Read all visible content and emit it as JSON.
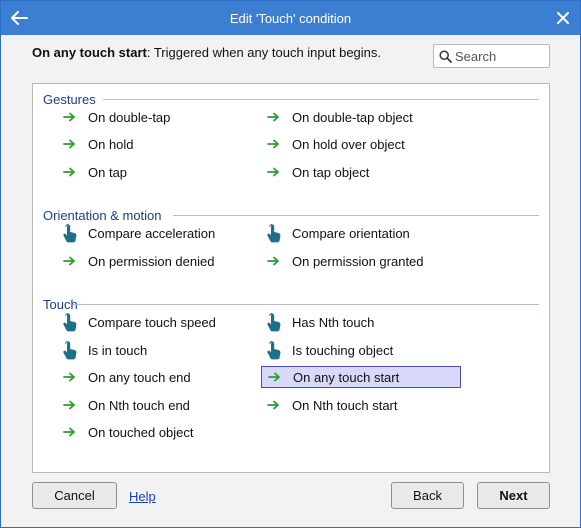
{
  "window": {
    "title": "Edit 'Touch' condition"
  },
  "description": {
    "name": "On any touch start",
    "text": ": Triggered when any touch input begins."
  },
  "search": {
    "placeholder": "Search"
  },
  "sections": [
    {
      "label": "Gestures",
      "items": [
        {
          "label": "On double-tap",
          "icon": "green-arrow-icon"
        },
        {
          "label": "On double-tap object",
          "icon": "green-arrow-icon"
        },
        {
          "label": "On hold",
          "icon": "green-arrow-icon"
        },
        {
          "label": "On hold over object",
          "icon": "green-arrow-icon"
        },
        {
          "label": "On tap",
          "icon": "green-arrow-icon"
        },
        {
          "label": "On tap object",
          "icon": "green-arrow-icon"
        }
      ]
    },
    {
      "label": "Orientation & motion",
      "items": [
        {
          "label": "Compare acceleration",
          "icon": "touch-hand-icon"
        },
        {
          "label": "Compare orientation",
          "icon": "touch-hand-icon"
        },
        {
          "label": "On permission denied",
          "icon": "green-arrow-icon"
        },
        {
          "label": "On permission granted",
          "icon": "green-arrow-icon"
        }
      ]
    },
    {
      "label": "Touch",
      "items": [
        {
          "label": "Compare touch speed",
          "icon": "touch-hand-icon"
        },
        {
          "label": "Has Nth touch",
          "icon": "touch-hand-icon"
        },
        {
          "label": "Is in touch",
          "icon": "touch-hand-icon"
        },
        {
          "label": "Is touching object",
          "icon": "touch-hand-icon"
        },
        {
          "label": "On any touch end",
          "icon": "green-arrow-icon"
        },
        {
          "label": "On any touch start",
          "icon": "green-arrow-icon",
          "selected": true
        },
        {
          "label": "On Nth touch end",
          "icon": "green-arrow-icon"
        },
        {
          "label": "On Nth touch start",
          "icon": "green-arrow-icon"
        },
        {
          "label": "On touched object",
          "icon": "green-arrow-icon"
        }
      ]
    }
  ],
  "buttons": {
    "cancel": "Cancel",
    "help": "Help",
    "back": "Back",
    "next": "Next"
  },
  "colors": {
    "titlebar": "#3c7fd2",
    "section_label": "#1a3d8f",
    "selection_bg": "#d8d8fa",
    "arrow": "#2e9b2e",
    "hand": "#1d6f8a"
  }
}
